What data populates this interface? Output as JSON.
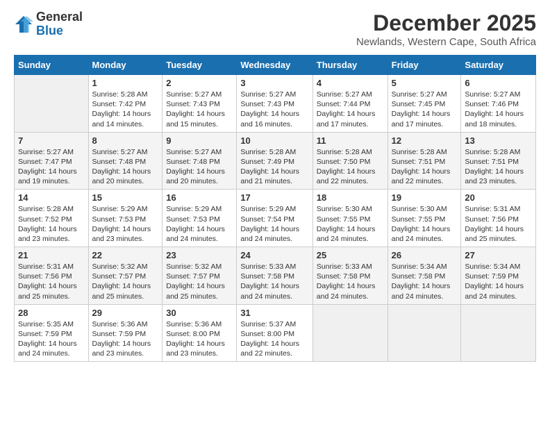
{
  "logo": {
    "general": "General",
    "blue": "Blue"
  },
  "header": {
    "month": "December 2025",
    "location": "Newlands, Western Cape, South Africa"
  },
  "days_of_week": [
    "Sunday",
    "Monday",
    "Tuesday",
    "Wednesday",
    "Thursday",
    "Friday",
    "Saturday"
  ],
  "weeks": [
    [
      {
        "day": "",
        "info": ""
      },
      {
        "day": "1",
        "info": "Sunrise: 5:28 AM\nSunset: 7:42 PM\nDaylight: 14 hours\nand 14 minutes."
      },
      {
        "day": "2",
        "info": "Sunrise: 5:27 AM\nSunset: 7:43 PM\nDaylight: 14 hours\nand 15 minutes."
      },
      {
        "day": "3",
        "info": "Sunrise: 5:27 AM\nSunset: 7:43 PM\nDaylight: 14 hours\nand 16 minutes."
      },
      {
        "day": "4",
        "info": "Sunrise: 5:27 AM\nSunset: 7:44 PM\nDaylight: 14 hours\nand 17 minutes."
      },
      {
        "day": "5",
        "info": "Sunrise: 5:27 AM\nSunset: 7:45 PM\nDaylight: 14 hours\nand 17 minutes."
      },
      {
        "day": "6",
        "info": "Sunrise: 5:27 AM\nSunset: 7:46 PM\nDaylight: 14 hours\nand 18 minutes."
      }
    ],
    [
      {
        "day": "7",
        "info": "Sunrise: 5:27 AM\nSunset: 7:47 PM\nDaylight: 14 hours\nand 19 minutes."
      },
      {
        "day": "8",
        "info": "Sunrise: 5:27 AM\nSunset: 7:48 PM\nDaylight: 14 hours\nand 20 minutes."
      },
      {
        "day": "9",
        "info": "Sunrise: 5:27 AM\nSunset: 7:48 PM\nDaylight: 14 hours\nand 20 minutes."
      },
      {
        "day": "10",
        "info": "Sunrise: 5:28 AM\nSunset: 7:49 PM\nDaylight: 14 hours\nand 21 minutes."
      },
      {
        "day": "11",
        "info": "Sunrise: 5:28 AM\nSunset: 7:50 PM\nDaylight: 14 hours\nand 22 minutes."
      },
      {
        "day": "12",
        "info": "Sunrise: 5:28 AM\nSunset: 7:51 PM\nDaylight: 14 hours\nand 22 minutes."
      },
      {
        "day": "13",
        "info": "Sunrise: 5:28 AM\nSunset: 7:51 PM\nDaylight: 14 hours\nand 23 minutes."
      }
    ],
    [
      {
        "day": "14",
        "info": "Sunrise: 5:28 AM\nSunset: 7:52 PM\nDaylight: 14 hours\nand 23 minutes."
      },
      {
        "day": "15",
        "info": "Sunrise: 5:29 AM\nSunset: 7:53 PM\nDaylight: 14 hours\nand 23 minutes."
      },
      {
        "day": "16",
        "info": "Sunrise: 5:29 AM\nSunset: 7:53 PM\nDaylight: 14 hours\nand 24 minutes."
      },
      {
        "day": "17",
        "info": "Sunrise: 5:29 AM\nSunset: 7:54 PM\nDaylight: 14 hours\nand 24 minutes."
      },
      {
        "day": "18",
        "info": "Sunrise: 5:30 AM\nSunset: 7:55 PM\nDaylight: 14 hours\nand 24 minutes."
      },
      {
        "day": "19",
        "info": "Sunrise: 5:30 AM\nSunset: 7:55 PM\nDaylight: 14 hours\nand 24 minutes."
      },
      {
        "day": "20",
        "info": "Sunrise: 5:31 AM\nSunset: 7:56 PM\nDaylight: 14 hours\nand 25 minutes."
      }
    ],
    [
      {
        "day": "21",
        "info": "Sunrise: 5:31 AM\nSunset: 7:56 PM\nDaylight: 14 hours\nand 25 minutes."
      },
      {
        "day": "22",
        "info": "Sunrise: 5:32 AM\nSunset: 7:57 PM\nDaylight: 14 hours\nand 25 minutes."
      },
      {
        "day": "23",
        "info": "Sunrise: 5:32 AM\nSunset: 7:57 PM\nDaylight: 14 hours\nand 25 minutes."
      },
      {
        "day": "24",
        "info": "Sunrise: 5:33 AM\nSunset: 7:58 PM\nDaylight: 14 hours\nand 24 minutes."
      },
      {
        "day": "25",
        "info": "Sunrise: 5:33 AM\nSunset: 7:58 PM\nDaylight: 14 hours\nand 24 minutes."
      },
      {
        "day": "26",
        "info": "Sunrise: 5:34 AM\nSunset: 7:58 PM\nDaylight: 14 hours\nand 24 minutes."
      },
      {
        "day": "27",
        "info": "Sunrise: 5:34 AM\nSunset: 7:59 PM\nDaylight: 14 hours\nand 24 minutes."
      }
    ],
    [
      {
        "day": "28",
        "info": "Sunrise: 5:35 AM\nSunset: 7:59 PM\nDaylight: 14 hours\nand 24 minutes."
      },
      {
        "day": "29",
        "info": "Sunrise: 5:36 AM\nSunset: 7:59 PM\nDaylight: 14 hours\nand 23 minutes."
      },
      {
        "day": "30",
        "info": "Sunrise: 5:36 AM\nSunset: 8:00 PM\nDaylight: 14 hours\nand 23 minutes."
      },
      {
        "day": "31",
        "info": "Sunrise: 5:37 AM\nSunset: 8:00 PM\nDaylight: 14 hours\nand 22 minutes."
      },
      {
        "day": "",
        "info": ""
      },
      {
        "day": "",
        "info": ""
      },
      {
        "day": "",
        "info": ""
      }
    ]
  ]
}
